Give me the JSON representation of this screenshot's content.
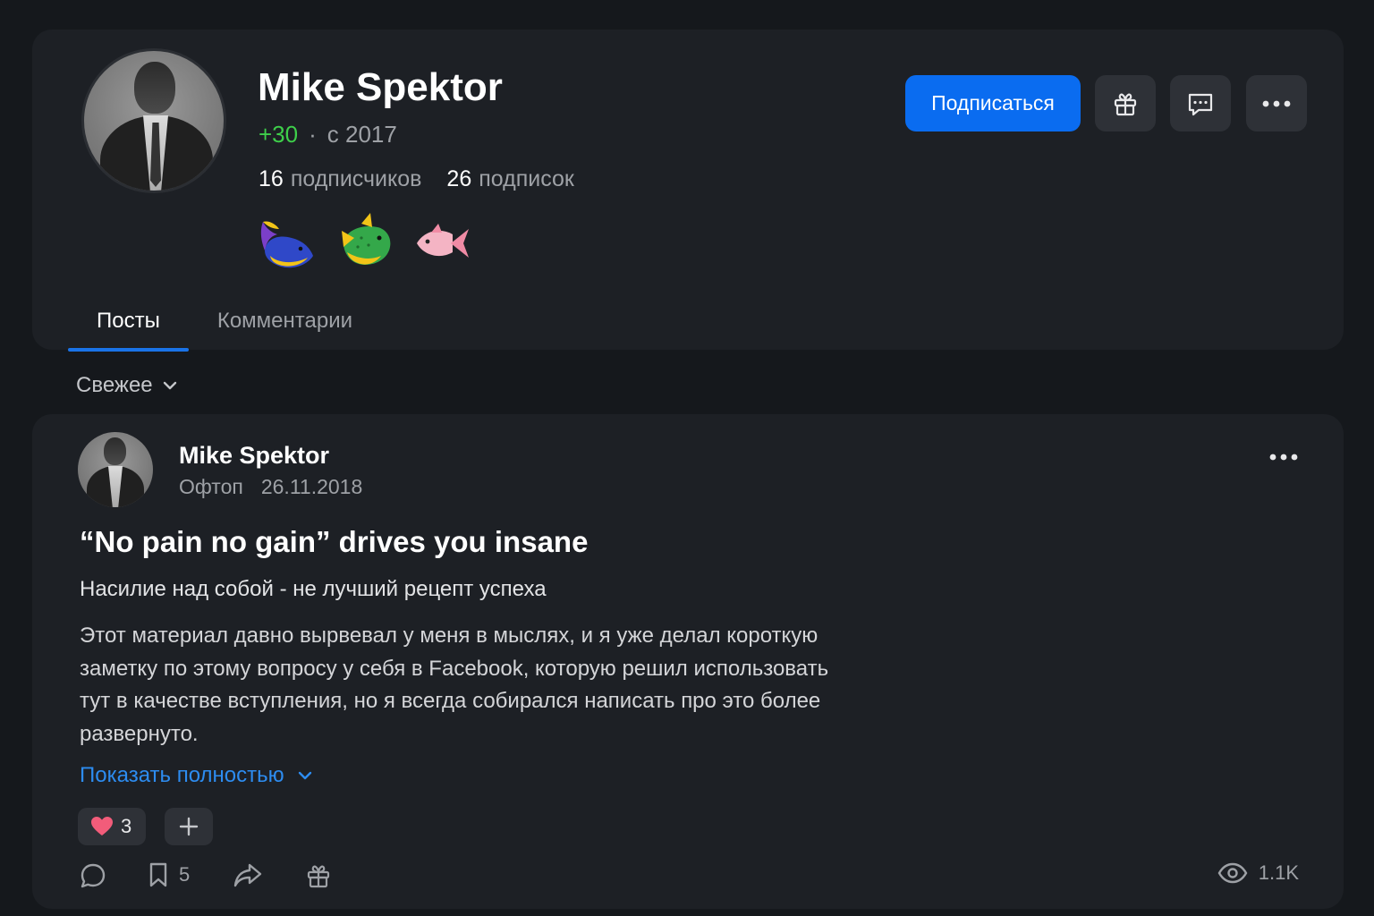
{
  "profile": {
    "name": "Mike Spektor",
    "rating": "+30",
    "since": "с 2017",
    "followers_count": "16",
    "followers_label": "подписчиков",
    "following_count": "26",
    "following_label": "подписок",
    "badges": [
      "whale-badge",
      "shark-badge",
      "fish-badge"
    ],
    "subscribe_label": "Подписаться",
    "tabs": [
      {
        "label": "Посты",
        "active": true
      },
      {
        "label": "Комментарии",
        "active": false
      }
    ]
  },
  "feed": {
    "sort_label": "Свежее"
  },
  "post": {
    "author": "Mike Spektor",
    "category": "Офтоп",
    "date": "26.11.2018",
    "title": "“No pain no gain” drives you insane",
    "subtitle": "Насилие над собой - не лучший рецепт успеха",
    "body": "Этот материал давно вырвевал у меня в мыслях, и я уже делал короткую заметку по этому вопросу у себя в Facebook, которую решил использовать тут в качестве вступления, но я всегда собирался написать про это более развернуто.",
    "show_more_label": "Показать полностью",
    "reaction_count": "3",
    "bookmarks_count": "5",
    "views": "1.1K"
  },
  "colors": {
    "accent": "#0a6cf0",
    "link": "#2d8cf0",
    "rating": "#3ecf4a",
    "background": "#15181c",
    "card": "#1d2025"
  }
}
